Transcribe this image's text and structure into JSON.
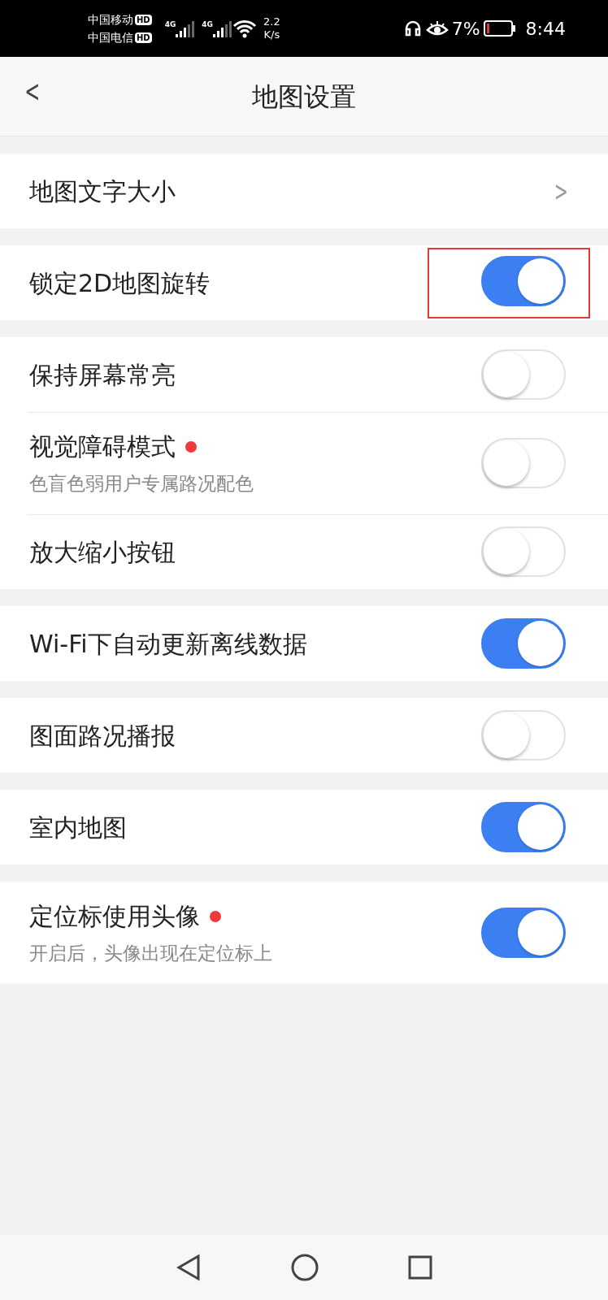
{
  "status_bar": {
    "carriers": [
      {
        "name": "中国移动",
        "badge": "HD"
      },
      {
        "name": "中国电信",
        "badge": "HD"
      }
    ],
    "networks": [
      "4G",
      "4G"
    ],
    "speed": [
      "2.2",
      "K/s"
    ],
    "battery_text": "7%",
    "time": "8:44"
  },
  "header": {
    "back": "<",
    "title": "地图设置"
  },
  "groups": [
    {
      "items": [
        {
          "kind": "chevron",
          "label": "地图文字大小",
          "arrow": ">"
        }
      ]
    },
    {
      "items": [
        {
          "kind": "switch",
          "label": "锁定2D地图旋转",
          "on": true,
          "highlighted": true
        }
      ]
    },
    {
      "items": [
        {
          "kind": "switch",
          "label": "保持屏幕常亮",
          "on": false
        },
        {
          "kind": "switch",
          "label": "视觉障碍模式",
          "dot": true,
          "subtitle": "色盲色弱用户专属路况配色",
          "on": false
        },
        {
          "kind": "switch",
          "label": "放大缩小按钮",
          "on": false
        }
      ]
    },
    {
      "items": [
        {
          "kind": "switch",
          "label": "Wi-Fi下自动更新离线数据",
          "on": true
        }
      ]
    },
    {
      "items": [
        {
          "kind": "switch",
          "label": "图面路况播报",
          "on": false
        }
      ]
    },
    {
      "items": [
        {
          "kind": "switch",
          "label": "室内地图",
          "on": true
        }
      ]
    },
    {
      "items": [
        {
          "kind": "switch",
          "label": "定位标使用头像",
          "dot": true,
          "subtitle": "开启后，头像出现在定位标上",
          "on": true
        }
      ]
    }
  ]
}
